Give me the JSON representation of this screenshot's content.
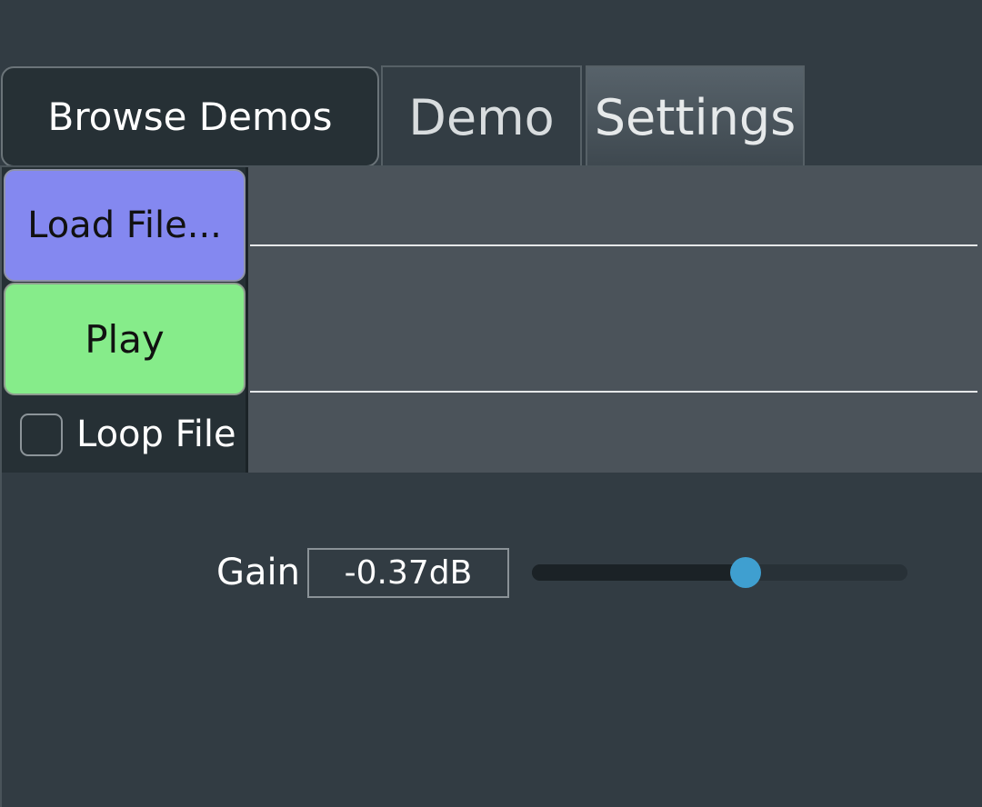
{
  "header": {
    "browse_label": "Browse Demos",
    "tabs": [
      {
        "label": "Demo",
        "active": false
      },
      {
        "label": "Settings",
        "active": true
      }
    ]
  },
  "controls": {
    "load_label": "Load File...",
    "play_label": "Play",
    "loop_label": "Loop File",
    "loop_checked": false
  },
  "gain": {
    "label": "Gain",
    "value_text": "-0.37dB",
    "slider_fraction": 0.57
  },
  "colors": {
    "load_button": "#8488f0",
    "play_button": "#86ec8a",
    "slider_thumb": "#3f9fd0"
  }
}
